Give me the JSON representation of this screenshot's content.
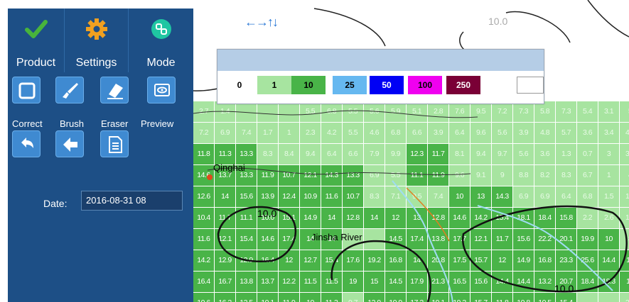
{
  "toolbar": {
    "product_label": "Product",
    "settings_label": "Settings",
    "mode_label": "Mode"
  },
  "tools": {
    "correct_label": "Correct",
    "brush_label": "Brush",
    "eraser_label": "Eraser",
    "preview_label": "Preview"
  },
  "date": {
    "label": "Date:",
    "value": "2016-08-31 08"
  },
  "legend": {
    "items": [
      {
        "label": "0",
        "color": "#ffffff",
        "text_color": "#000000"
      },
      {
        "label": "1",
        "color": "#a7e4a0",
        "text_color": "#000000"
      },
      {
        "label": "10",
        "color": "#49b448",
        "text_color": "#000000"
      },
      {
        "label": "25",
        "color": "#66b8f0",
        "text_color": "#000000"
      },
      {
        "label": "50",
        "color": "#0000f5",
        "text_color": "#ffffff"
      },
      {
        "label": "100",
        "color": "#f000f0",
        "text_color": "#000000"
      },
      {
        "label": "250",
        "color": "#7a0036",
        "text_color": "#ffffff"
      }
    ]
  },
  "map": {
    "place_labels": [
      "Qinghai",
      "Jinsha River"
    ],
    "contour_labels": [
      "10.0",
      "10.0",
      "10.0"
    ],
    "rows": [
      [
        "2.7",
        "1.4",
        "",
        "",
        "",
        "5.5",
        "6.8",
        "5.5",
        "5.6",
        "5.9",
        "5.1",
        "2.8",
        "7.6",
        "9.5",
        "7.2",
        "7.3",
        "5.8",
        "7.3",
        "5.4",
        "3.1",
        "5"
      ],
      [
        "7.2",
        "6.9",
        "7.4",
        "1.7",
        "1",
        "2.3",
        "4.2",
        "5.5",
        "4.6",
        "6.8",
        "6.6",
        "3.9",
        "6.4",
        "9.6",
        "5.6",
        "3.9",
        "4.8",
        "5.7",
        "3.6",
        "3.4",
        "4.5"
      ],
      [
        "11.8",
        "11.3",
        "13.3",
        "8.3",
        "8.4",
        "9.4",
        "6.4",
        "6.6",
        "7.9",
        "9.9",
        "12.3",
        "11.7",
        "8.1",
        "9.4",
        "9.7",
        "5.6",
        "3.6",
        "1.3",
        "0.7",
        "3",
        "3.2"
      ],
      [
        "14.6",
        "13.7",
        "13.3",
        "11.9",
        "10.7",
        "12.1",
        "14.3",
        "13.3",
        "6.9",
        "5.5",
        "11.1",
        "11.9",
        "9.6",
        "9.1",
        "9",
        "8.8",
        "8.2",
        "8.3",
        "6.7",
        "1",
        "4"
      ],
      [
        "12.6",
        "14",
        "15.6",
        "13.9",
        "12.4",
        "10.9",
        "11.6",
        "10.7",
        "8.3",
        "7.1",
        "9.5",
        "7.4",
        "10",
        "13",
        "14.3",
        "6.9",
        "6.9",
        "6.4",
        "6.8",
        "1.5",
        "1.1"
      ],
      [
        "10.4",
        "11.7",
        "11.1",
        "10.0",
        "15.1",
        "14.9",
        "14",
        "12.8",
        "14",
        "12",
        "13",
        "12.8",
        "14.6",
        "14.2",
        "15.4",
        "18.1",
        "18.4",
        "15.8",
        "2.2",
        "2.6",
        "1.8"
      ],
      [
        "11.6",
        "12.1",
        "15.4",
        "14.6",
        "17.4",
        "14",
        "14",
        "",
        "",
        "14.5",
        "17.4",
        "13.8",
        "17.7",
        "12.1",
        "11.7",
        "15.6",
        "22.2",
        "20.1",
        "19.9",
        "10",
        "8"
      ],
      [
        "14.2",
        "12.9",
        "12.9",
        "16.4",
        "12",
        "12.7",
        "15.4",
        "17.6",
        "19.2",
        "16.8",
        "14",
        "20.8",
        "17.5",
        "15.7",
        "12",
        "14.9",
        "16.8",
        "23.3",
        "25.6",
        "14.4",
        "10"
      ],
      [
        "16.4",
        "16.7",
        "13.8",
        "13.7",
        "12.2",
        "11.5",
        "11.5",
        "19",
        "15",
        "14.5",
        "17.9",
        "21.3",
        "16.5",
        "15.6",
        "14.4",
        "14.4",
        "13.2",
        "20.7",
        "18.4",
        "18.3",
        "15"
      ],
      [
        "10.6",
        "16.2",
        "12.5",
        "10.1",
        "11.9",
        "10",
        "11.3",
        "9.7",
        "12.9",
        "10.9",
        "17.2",
        "19.1",
        "19.3",
        "15.7",
        "11.8",
        "10.8",
        "10.5",
        "15.4",
        "",
        "",
        "3.4"
      ]
    ]
  }
}
